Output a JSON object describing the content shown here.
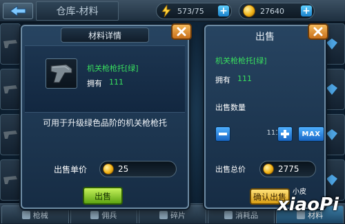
{
  "topbar": {
    "title": "仓库-材料",
    "energy": "573/75",
    "gold": "27640"
  },
  "tabs": [
    {
      "label": "枪械",
      "active": false
    },
    {
      "label": "佣兵",
      "active": false
    },
    {
      "label": "碎片",
      "active": false
    },
    {
      "label": "消耗品",
      "active": false
    },
    {
      "label": "材料",
      "active": true
    }
  ],
  "detail_panel": {
    "title": "材料详情",
    "item_name": "机关枪枪托[绿]",
    "own_label": "拥有",
    "own_count": "111",
    "description": "可用于升级绿色品阶的机关枪枪托",
    "price_label": "出售单价",
    "unit_price": "25",
    "sell_button": "出售"
  },
  "sell_panel": {
    "title": "出售",
    "item_name": "机关枪枪托[绿]",
    "own_label": "拥有",
    "own_count": "111",
    "quantity_label": "出售数量",
    "quantity": "111",
    "max_label": "MAX",
    "total_label": "出售总价",
    "total_price": "2775",
    "confirm_button": "确认出售"
  },
  "watermark": {
    "small": "小皮",
    "big": "xiaoPi"
  },
  "colors": {
    "item_green": "#39e05e",
    "panel_bg": "#274461",
    "close_orange": "#e08a2c",
    "button_green": "#8ccf2f",
    "button_yellow": "#f0c33e"
  }
}
